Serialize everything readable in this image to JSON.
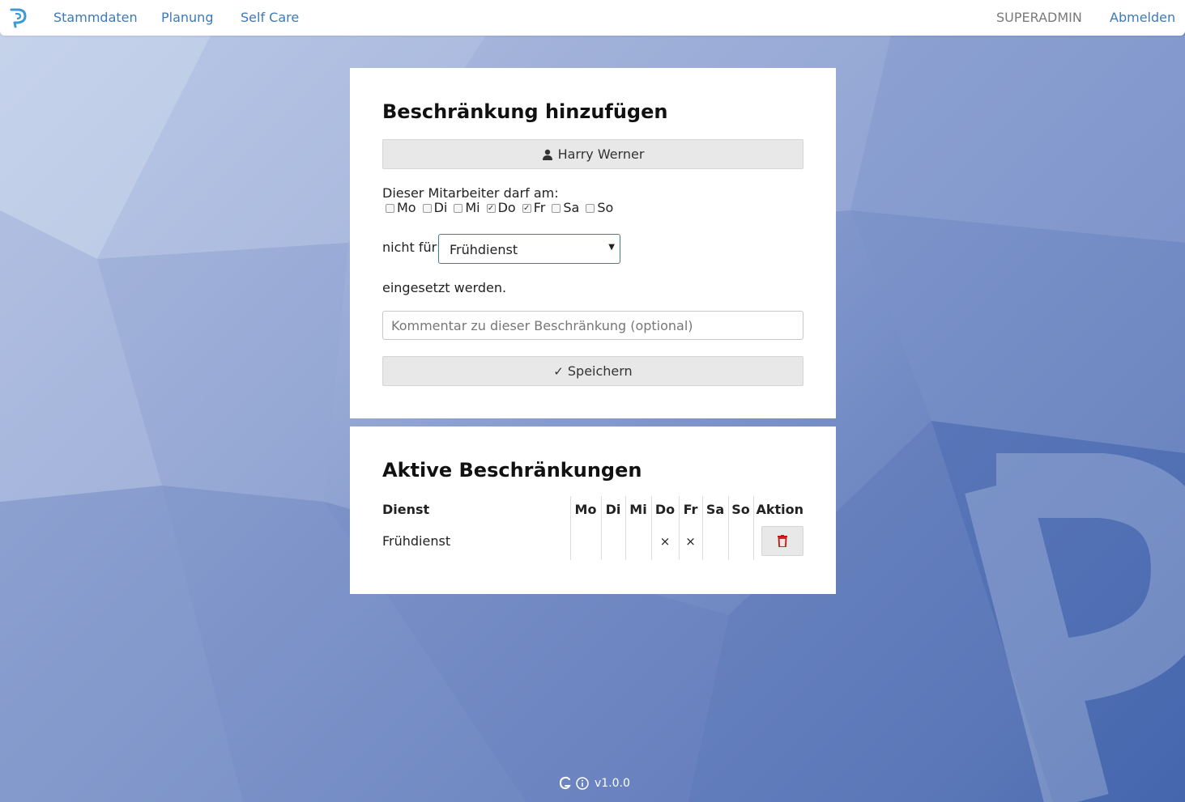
{
  "nav": {
    "links": [
      "Stammdaten",
      "Planung",
      "Self Care"
    ],
    "user": "SUPERADMIN",
    "logout": "Abmelden"
  },
  "add_card": {
    "title": "Beschränkung hinzufügen",
    "employee_name": "Harry Werner",
    "intro_text": "Dieser Mitarbeiter darf am:",
    "days": [
      {
        "label": "Mo",
        "checked": false
      },
      {
        "label": "Di",
        "checked": false
      },
      {
        "label": "Mi",
        "checked": false
      },
      {
        "label": "Do",
        "checked": true
      },
      {
        "label": "Fr",
        "checked": true
      },
      {
        "label": "Sa",
        "checked": false
      },
      {
        "label": "So",
        "checked": false
      }
    ],
    "not_for_label": "nicht für:",
    "shift_selected": "Frühdienst",
    "used_text": "eingesetzt werden.",
    "comment_placeholder": "Kommentar zu dieser Beschränkung (optional)",
    "save_label": "Speichern"
  },
  "active_card": {
    "title": "Aktive Beschränkungen",
    "headers": {
      "dienst": "Dienst",
      "days": [
        "Mo",
        "Di",
        "Mi",
        "Do",
        "Fr",
        "Sa",
        "So"
      ],
      "aktion": "Aktion"
    },
    "rows": [
      {
        "dienst": "Frühdienst",
        "marks": [
          "",
          "",
          "",
          "×",
          "×",
          "",
          ""
        ]
      }
    ]
  },
  "footer": {
    "version": "v1.0.0"
  },
  "colors": {
    "accent": "#3d7ab8",
    "delete": "#cc1111"
  }
}
